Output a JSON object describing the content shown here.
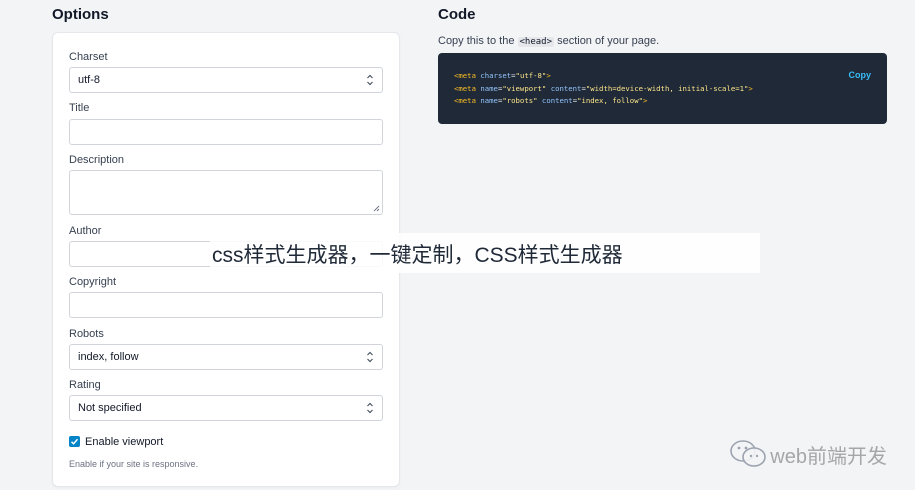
{
  "options": {
    "heading": "Options",
    "charset": {
      "label": "Charset",
      "value": "utf-8"
    },
    "title": {
      "label": "Title",
      "value": ""
    },
    "description": {
      "label": "Description",
      "value": ""
    },
    "author": {
      "label": "Author",
      "value": ""
    },
    "copyright": {
      "label": "Copyright",
      "value": ""
    },
    "robots": {
      "label": "Robots",
      "value": "index, follow"
    },
    "rating": {
      "label": "Rating",
      "value": "Not specified"
    },
    "viewport": {
      "label": "Enable viewport",
      "checked": true,
      "help": "Enable if your site is responsive."
    }
  },
  "code": {
    "heading": "Code",
    "desc_before": "Copy this to the ",
    "desc_code": "<head>",
    "desc_after": " section of your page.",
    "copy_label": "Copy",
    "lines": [
      {
        "tag": "<meta",
        "attrs": [
          {
            "name": "charset",
            "value": "\"utf-8\""
          }
        ],
        "close": ">"
      },
      {
        "tag": "<meta",
        "attrs": [
          {
            "name": "name",
            "value": "\"viewport\""
          },
          {
            "name": "content",
            "value": "\"width=device-width, initial-scale=1\""
          }
        ],
        "close": ">"
      },
      {
        "tag": "<meta",
        "attrs": [
          {
            "name": "name",
            "value": "\"robots\""
          },
          {
            "name": "content",
            "value": "\"index, follow\""
          }
        ],
        "close": ">"
      }
    ]
  },
  "overlay": {
    "banner_text": "css样式生成器，一键定制，CSS样式生成器",
    "watermark_text": "web前端开发"
  },
  "colors": {
    "accent": "#0284c7",
    "code_bg": "#1f2937",
    "code_tag": "#fbbf24",
    "code_attr": "#93c5fd",
    "code_value": "#fde68a",
    "copy": "#38bdf8"
  }
}
